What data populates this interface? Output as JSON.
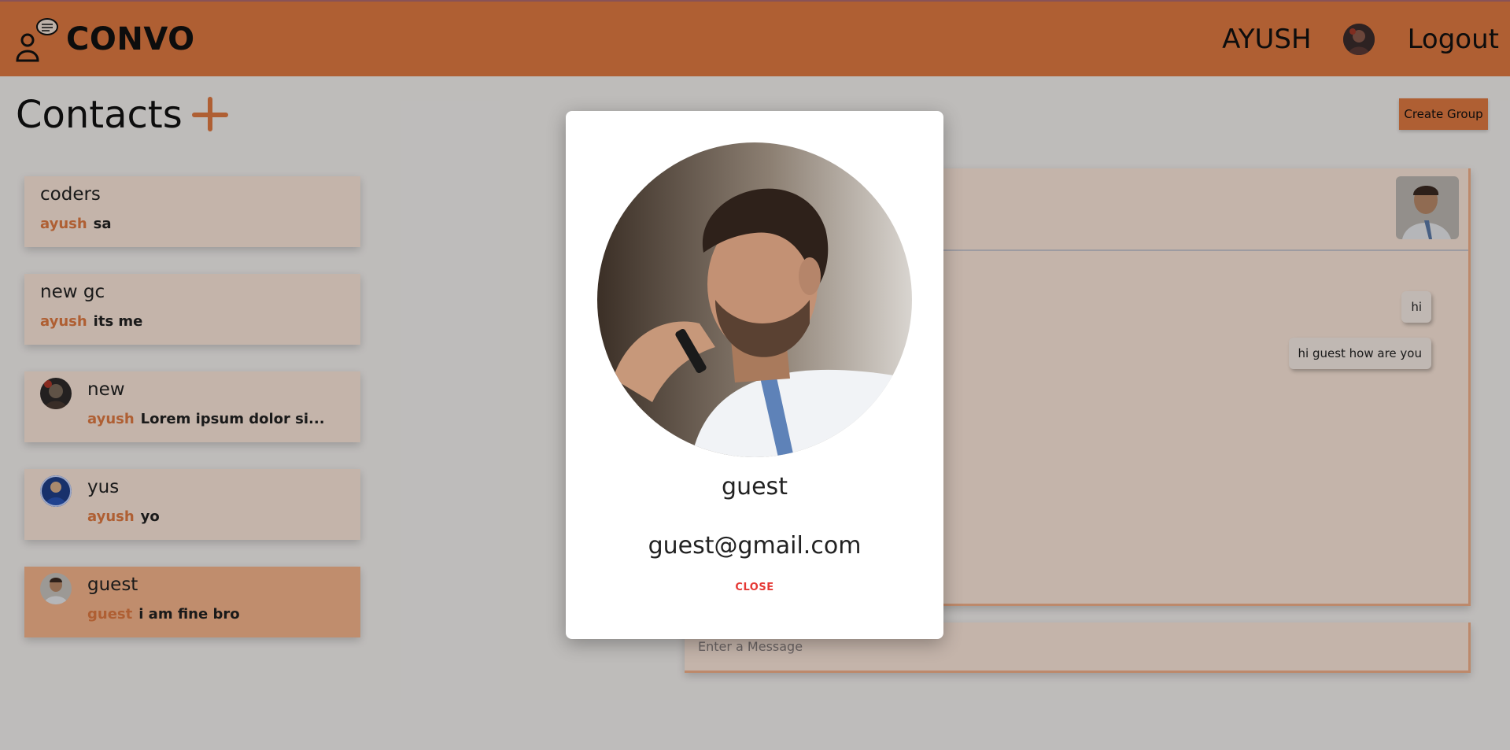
{
  "header": {
    "brand": "CONVO",
    "user_name": "AYUSH",
    "logout_label": "Logout"
  },
  "contacts": {
    "title": "Contacts",
    "items": [
      {
        "name": "coders",
        "sender": "ayush",
        "message": "sa",
        "has_avatar": false
      },
      {
        "name": "new gc",
        "sender": "ayush",
        "message": "its me",
        "has_avatar": false
      },
      {
        "name": "new",
        "sender": "ayush",
        "message": "Lorem ipsum dolor si...",
        "has_avatar": true
      },
      {
        "name": "yus",
        "sender": "ayush",
        "message": "yo",
        "has_avatar": true
      },
      {
        "name": "guest",
        "sender": "guest",
        "message": "i am fine bro",
        "has_avatar": true,
        "active": true
      }
    ]
  },
  "toolbar": {
    "create_group_label": "Create Group"
  },
  "chat": {
    "messages": [
      {
        "text": "hi"
      },
      {
        "text": "hi guest how are you"
      }
    ],
    "input_placeholder": "Enter a Message"
  },
  "modal": {
    "name": "guest",
    "email": "guest@gmail.com",
    "close_label": "CLOSE"
  },
  "colors": {
    "accent": "#e07a42",
    "card_bg": "#fbe7da",
    "active_card_bg": "#f7b58c",
    "close_red": "#e53935"
  }
}
